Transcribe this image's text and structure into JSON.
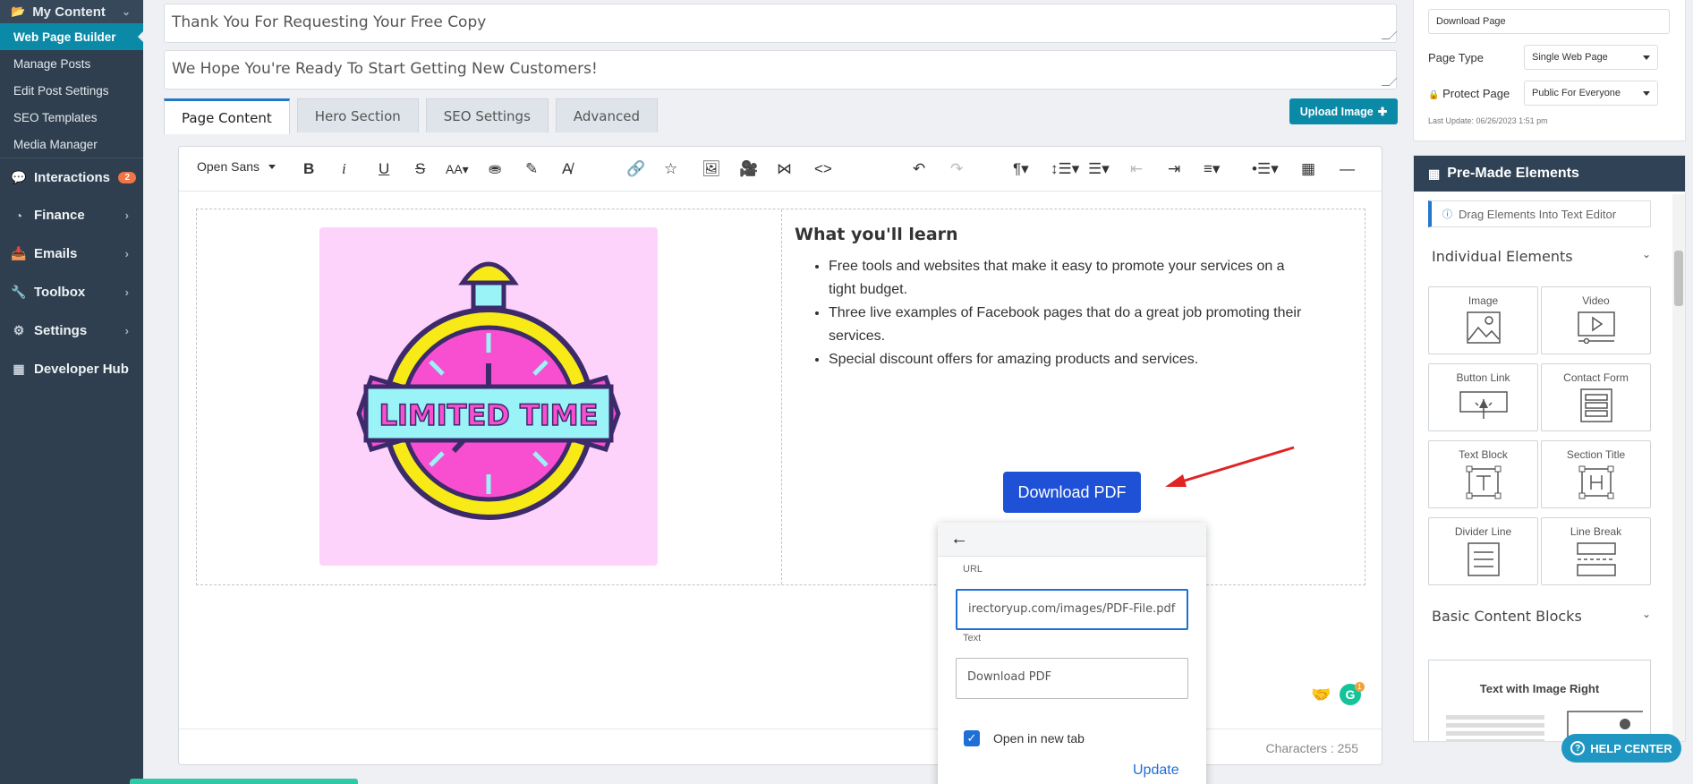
{
  "sidebar": {
    "header": {
      "label": "My Content"
    },
    "sub_items": [
      {
        "label": "Web Page Builder",
        "active": true
      },
      {
        "label": "Manage Posts"
      },
      {
        "label": "Edit Post Settings"
      },
      {
        "label": "SEO Templates"
      },
      {
        "label": "Media Manager"
      }
    ],
    "main_items": [
      {
        "label": "Interactions",
        "icon": "chat-icon",
        "badge": "2"
      },
      {
        "label": "Finance",
        "icon": "pie-chart-icon"
      },
      {
        "label": "Emails",
        "icon": "inbox-icon"
      },
      {
        "label": "Toolbox",
        "icon": "wrench-icon"
      },
      {
        "label": "Settings",
        "icon": "gear-icon"
      },
      {
        "label": "Developer Hub",
        "icon": "grid-icon"
      }
    ]
  },
  "fields": {
    "headline": "Thank You For Requesting Your Free Copy",
    "subheadline": "We Hope You're Ready To Start Getting New Customers!"
  },
  "tabs": [
    {
      "label": "Page Content",
      "active": true
    },
    {
      "label": "Hero Section"
    },
    {
      "label": "SEO Settings"
    },
    {
      "label": "Advanced"
    }
  ],
  "upload_button": "Upload Image",
  "editor": {
    "font": "Open Sans",
    "learn_title": "What you'll learn",
    "learn_items": [
      "Free tools and websites that make it easy to promote your services on a tight budget.",
      "Three live examples of Facebook pages that do a great job promoting their services.",
      "Special discount offers for amazing products and services."
    ],
    "download_button": "Download PDF",
    "promo_text": "LIMITED TIME",
    "char_count": "Characters : 255"
  },
  "link_popup": {
    "url_label": "URL",
    "url_value": "irectoryup.com/images/PDF-File.pdf",
    "text_label": "Text",
    "text_value": "Download PDF",
    "checkbox_label": "Open in new tab",
    "update_label": "Update"
  },
  "page_settings": {
    "page_name": "Download Page",
    "page_type_label": "Page Type",
    "page_type_value": "Single Web Page",
    "protect_label": "Protect Page",
    "protect_value": "Public For Everyone",
    "last_update": "Last Update: 06/26/2023 1:51 pm"
  },
  "elements_panel": {
    "title": "Pre-Made Elements",
    "info": "Drag Elements Into Text Editor",
    "section_individual": "Individual Elements",
    "section_basic": "Basic Content Blocks",
    "elements": [
      {
        "label": "Image"
      },
      {
        "label": "Video"
      },
      {
        "label": "Button Link"
      },
      {
        "label": "Contact Form"
      },
      {
        "label": "Text Block"
      },
      {
        "label": "Section Title"
      },
      {
        "label": "Divider Line"
      },
      {
        "label": "Line Break"
      }
    ],
    "block_title": "Text with Image Right"
  },
  "help_center": "HELP CENTER",
  "colors": {
    "sidebar": "#2f3f4f",
    "active": "#0b8aa8",
    "primary_button": "#1f51d6",
    "promo_bg": "#fdd3fb"
  }
}
